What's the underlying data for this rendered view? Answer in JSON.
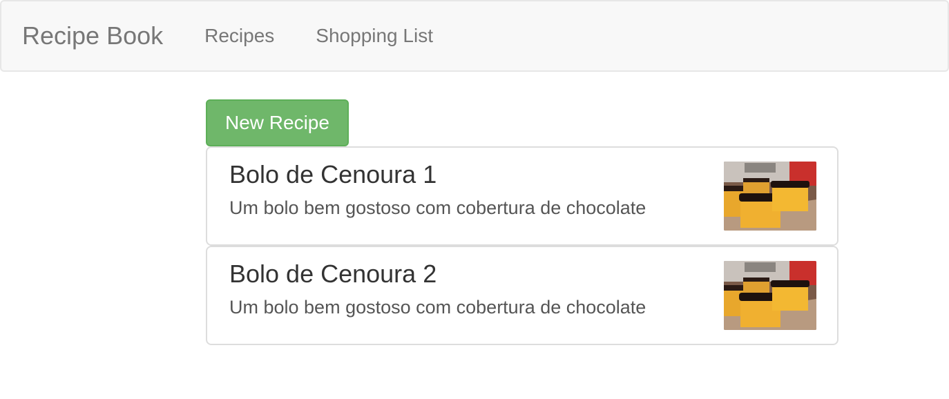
{
  "navbar": {
    "brand": "Recipe Book",
    "links": [
      {
        "label": "Recipes"
      },
      {
        "label": "Shopping List"
      }
    ]
  },
  "actions": {
    "new_recipe_label": "New Recipe"
  },
  "recipes": [
    {
      "name": "Bolo de Cenoura 1",
      "description": "Um bolo bem gostoso com cobertura de chocolate",
      "image": "carrot-cake-photo"
    },
    {
      "name": "Bolo de Cenoura 2",
      "description": "Um bolo bem gostoso com cobertura de chocolate",
      "image": "carrot-cake-photo"
    }
  ],
  "colors": {
    "navbar_bg": "#f8f8f8",
    "success": "#5cb85c",
    "border": "#dddddd"
  }
}
